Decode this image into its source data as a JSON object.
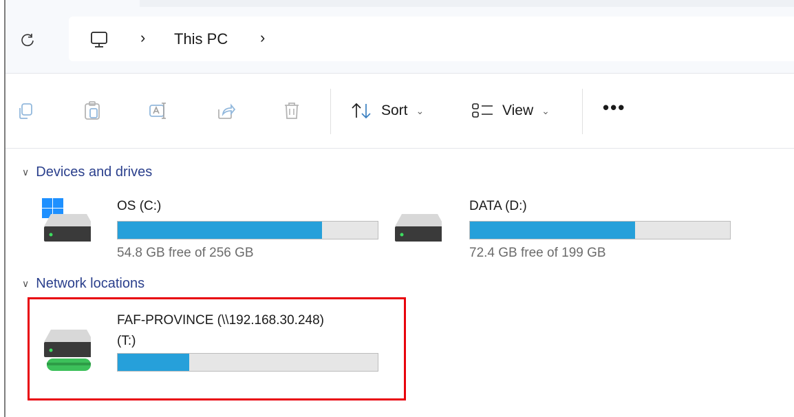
{
  "address": {
    "breadcrumb": [
      "This PC"
    ]
  },
  "toolbar": {
    "sort_label": "Sort",
    "view_label": "View",
    "more_label": "•••"
  },
  "sections": {
    "devices": {
      "label": "Devices and drives"
    },
    "network": {
      "label": "Network locations"
    }
  },
  "drives": [
    {
      "name": "OS (C:)",
      "free_text": "54.8 GB free of 256 GB",
      "used_fraction": 0.786
    },
    {
      "name": "DATA (D:)",
      "free_text": "72.4 GB free of 199 GB",
      "used_fraction": 0.636
    }
  ],
  "network_drives": [
    {
      "name_line1": "FAF-PROVINCE (\\\\192.168.30.248)",
      "name_line2": "(T:)",
      "used_fraction": 0.275
    }
  ],
  "colors": {
    "accent": "#26a0da",
    "section_text": "#2a3f8c",
    "highlight": "#e8000b"
  }
}
